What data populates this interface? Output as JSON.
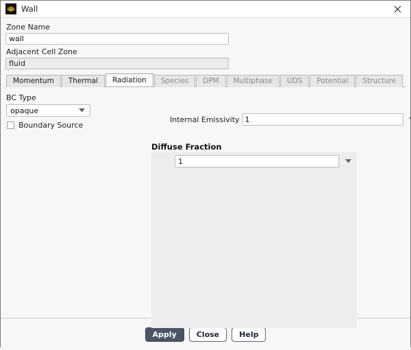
{
  "window": {
    "title": "Wall",
    "icon": "wall-mesh-icon",
    "close_icon": "close-icon"
  },
  "form": {
    "zone_name_label": "Zone Name",
    "zone_name_value": "wall",
    "adjacent_cell_zone_label": "Adjacent Cell Zone",
    "adjacent_cell_zone_value": "fluid"
  },
  "tabs": [
    {
      "label": "Momentum",
      "active": false,
      "enabled": true
    },
    {
      "label": "Thermal",
      "active": false,
      "enabled": true
    },
    {
      "label": "Radiation",
      "active": true,
      "enabled": true
    },
    {
      "label": "Species",
      "active": false,
      "enabled": false
    },
    {
      "label": "DPM",
      "active": false,
      "enabled": false
    },
    {
      "label": "Multiphase",
      "active": false,
      "enabled": false
    },
    {
      "label": "UDS",
      "active": false,
      "enabled": false
    },
    {
      "label": "Potential",
      "active": false,
      "enabled": false
    },
    {
      "label": "Structure",
      "active": false,
      "enabled": false
    }
  ],
  "radiation": {
    "bc_type_label": "BC Type",
    "bc_type_value": "opaque",
    "boundary_source_label": "Boundary Source",
    "boundary_source_checked": false,
    "internal_emissivity_label": "Internal Emissivity",
    "internal_emissivity_value": "1",
    "diffuse_fraction_label": "Diffuse Fraction",
    "diffuse_fraction_value": "1"
  },
  "footer": {
    "apply_label": "Apply",
    "close_label": "Close",
    "help_label": "Help"
  },
  "colors": {
    "accent": "#4a5568",
    "panel": "#ededed",
    "background": "#f7f7f7"
  }
}
